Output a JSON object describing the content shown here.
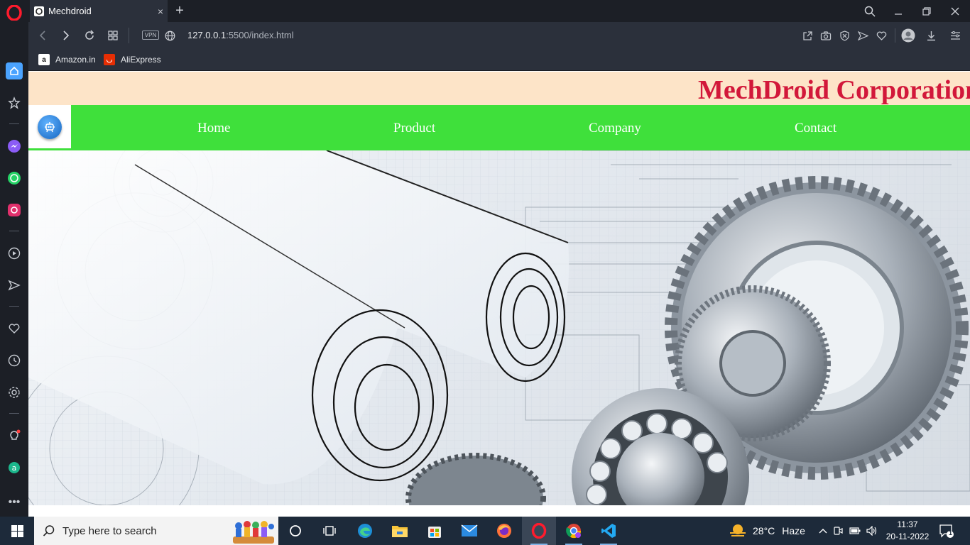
{
  "browser": {
    "tab_title": "Mechdroid",
    "tab_close": "×",
    "new_tab": "+",
    "vpn_label": "VPN",
    "url_host": "127.0.0.1",
    "url_path": ":5500/index.html"
  },
  "bookmarks": [
    {
      "label": "Amazon.in",
      "icon": "amazon-icon"
    },
    {
      "label": "AliExpress",
      "icon": "aliexpress-icon"
    }
  ],
  "site": {
    "banner_title": "MechDroid Corporation",
    "nav": [
      "Home",
      "Product",
      "Company",
      "Contact"
    ],
    "colors": {
      "banner_bg": "#fde4c8",
      "title": "#d2183a",
      "nav_bg": "#3fe03b"
    }
  },
  "taskbar": {
    "search_placeholder": "Type here to search",
    "weather_temp": "28°C",
    "weather_desc": "Haze",
    "time": "11:37",
    "date": "20-11-2022",
    "notification_count": "1"
  }
}
